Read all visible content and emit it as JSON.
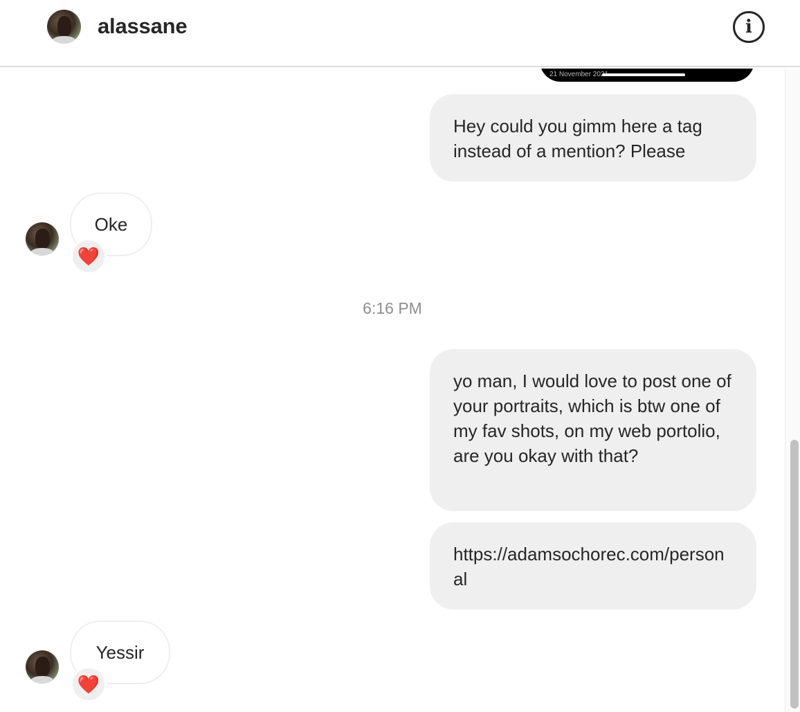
{
  "header": {
    "username": "alassane",
    "avatar_icon": "profile-photo",
    "info_icon": "info-circle-icon",
    "info_glyph": "i"
  },
  "thread": {
    "media_preview": {
      "date_text": "21 November 2021"
    },
    "messages": [
      {
        "direction": "outgoing",
        "text": "Hey could you gimm here a tag instead of a mention? Please"
      },
      {
        "direction": "incoming",
        "text": "Oke",
        "reaction": "❤️"
      },
      {
        "type": "timestamp",
        "text": "6:16 PM"
      },
      {
        "direction": "outgoing",
        "text": "yo man, I would love to post one of your portraits, which is btw one of my fav shots, on my web portolio, are you okay with that?"
      },
      {
        "direction": "outgoing",
        "text": "https://adamsochorec.com/personal"
      },
      {
        "direction": "incoming",
        "text": "Yessir",
        "reaction": "❤️"
      }
    ]
  },
  "colors": {
    "outgoing_bubble": "#efefef",
    "text": "#262626",
    "timestamp": "#8e8e8e",
    "reaction_heart": "#e0192e",
    "divider": "#dbdbdb"
  }
}
